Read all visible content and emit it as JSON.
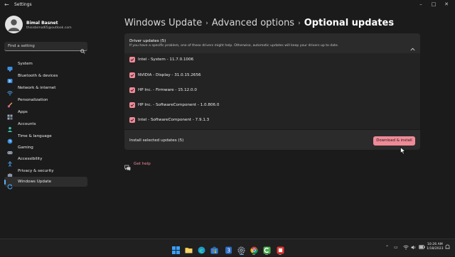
{
  "window": {
    "title": "Settings"
  },
  "user": {
    "name": "Bimal Basnet",
    "email": "thisisbimal65@outlook.com"
  },
  "search": {
    "placeholder": "Find a setting"
  },
  "nav": [
    {
      "label": "System",
      "icon": "monitor-icon"
    },
    {
      "label": "Bluetooth & devices",
      "icon": "bluetooth-icon"
    },
    {
      "label": "Network & internet",
      "icon": "wifi-icon"
    },
    {
      "label": "Personalization",
      "icon": "brush-icon"
    },
    {
      "label": "Apps",
      "icon": "apps-grid-icon"
    },
    {
      "label": "Accounts",
      "icon": "person-icon"
    },
    {
      "label": "Time & language",
      "icon": "globe-clock-icon"
    },
    {
      "label": "Gaming",
      "icon": "gamepad-icon"
    },
    {
      "label": "Accessibility",
      "icon": "accessibility-icon"
    },
    {
      "label": "Privacy & security",
      "icon": "shield-icon"
    },
    {
      "label": "Windows Update",
      "icon": "update-icon",
      "active": true
    }
  ],
  "breadcrumb": [
    "Windows Update",
    "Advanced options",
    "Optional updates"
  ],
  "driver_updates": {
    "title": "Driver updates (5)",
    "description": "If you have a specific problem, one of these drivers might help. Otherwise, automatic updates will keep your drivers up to date.",
    "items": [
      {
        "label": "Intel - System - 11.7.0.1006",
        "checked": true
      },
      {
        "label": "NVIDIA - Display - 31.0.15.2656",
        "checked": true
      },
      {
        "label": "HP Inc. - Firmware - 15.12.0.0",
        "checked": true
      },
      {
        "label": "HP Inc. - SoftwareComponent - 1.0.806.0",
        "checked": true
      },
      {
        "label": "Intel - SoftwareComponent - 7.9.1.3",
        "checked": true
      }
    ],
    "footer_text": "Install selected updates (5)",
    "button_label": "Download & install"
  },
  "help": {
    "label": "Get help"
  },
  "taskbar": {
    "time": "10:26 AM",
    "date": "1/18/2023",
    "apps": [
      "windows-start-icon",
      "file-explorer-icon",
      "edge-icon",
      "store-icon",
      "settings-icon",
      "chrome-icon",
      "camtasia-icon",
      "recorder-icon"
    ]
  },
  "colors": {
    "accent": "#f08a97",
    "background": "#1b1b1b",
    "panel": "#232323",
    "nav_indicator": "#5fb2f2"
  }
}
